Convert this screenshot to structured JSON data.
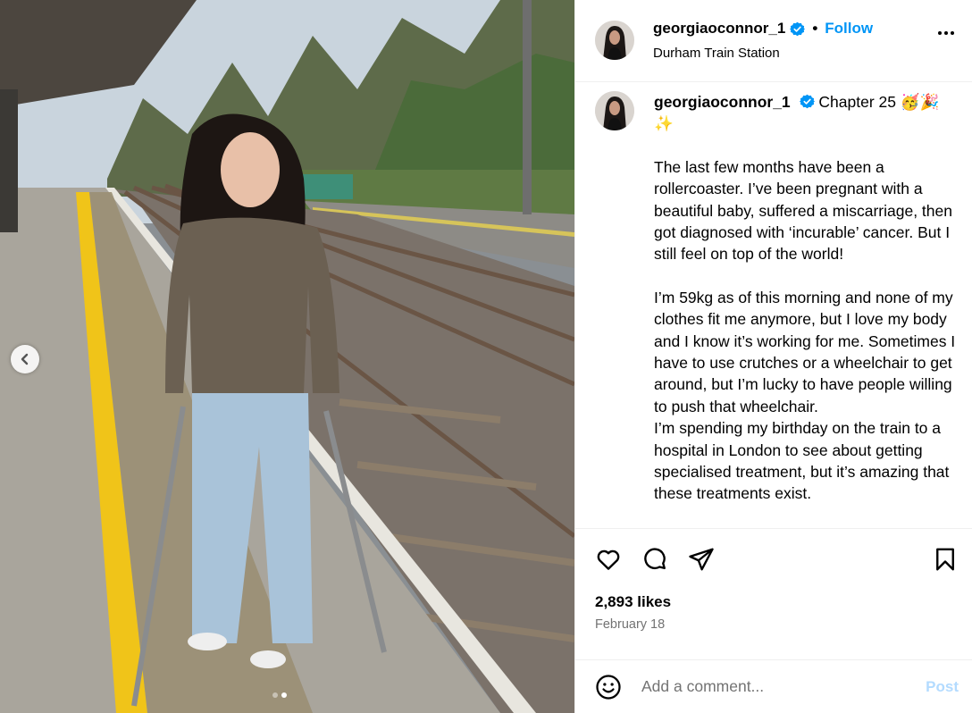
{
  "post": {
    "username": "georgiaoconnor_1",
    "separator": "•",
    "follow_label": "Follow",
    "location": "Durham Train Station"
  },
  "caption": {
    "username": "georgiaoconnor_1",
    "headline": "Chapter 25 🥳🎉✨",
    "paragraphs": [
      "The last few months have been a rollercoaster. I’ve been pregnant with a beautiful baby, suffered a miscarriage, then got diagnosed with ‘incurable’ cancer. But I still feel on top of the world!",
      "I’m 59kg as of this morning and none of my clothes fit me anymore, but I love my body and I know it’s working for me. Sometimes I have to use crutches or a wheelchair to get around, but I’m lucky to have people willing to push that wheelchair.",
      "I’m spending my birthday on the train to a hospital in London to see about getting specialised treatment, but it’s amazing that these treatments exist."
    ]
  },
  "engagement": {
    "likes": "2,893 likes",
    "date": "February 18"
  },
  "comment_box": {
    "placeholder": "Add a comment...",
    "post_label": "Post"
  },
  "carousel": {
    "slide_count": 2,
    "active_slide": 2
  },
  "icons": {
    "verified": "verified-badge-icon",
    "more": "more-options-icon",
    "like": "heart-icon",
    "comment": "comment-icon",
    "share": "share-icon",
    "save": "bookmark-icon",
    "emoji": "emoji-icon",
    "prev": "chevron-left-icon"
  },
  "colors": {
    "accent": "#0095f6",
    "verified": "#0095f6",
    "post_disabled": "#b3dbff",
    "muted_text": "#737373"
  }
}
